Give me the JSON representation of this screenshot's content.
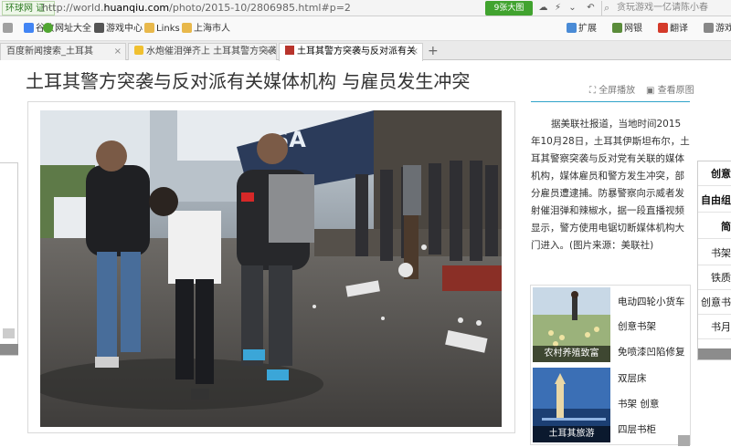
{
  "browser": {
    "site_badge": "环球网 证 ·",
    "url_prefix": "http://world.",
    "url_host": "huanqiu.com",
    "url_path": "/photo/2015-10/2806985.html#p=2",
    "translate_label": "9张大图",
    "search_placeholder": "贪玩游戏一亿请陈小春"
  },
  "bookmarks": [
    {
      "label": "谷歌",
      "color": "#4285f4"
    },
    {
      "label": "网址大全",
      "color": "#51a632"
    },
    {
      "label": "游戏中心",
      "color": "#555555"
    },
    {
      "label": "Links",
      "color": "#e8b84b"
    },
    {
      "label": "上海市人",
      "color": "#e8b84b"
    }
  ],
  "toolbar_right": [
    {
      "label": "扩展",
      "color": "#4a8bd6"
    },
    {
      "label": "网银",
      "color": "#5a8c3a"
    },
    {
      "label": "翻译",
      "color": "#d43a2a"
    },
    {
      "label": "游戏",
      "color": "#888888"
    }
  ],
  "tabs": [
    {
      "label": "百度新闻搜索_土耳其",
      "active": false
    },
    {
      "label": "水炮催泪弹齐上 土耳其警方突袭",
      "active": false
    },
    {
      "label": "土耳其警方突袭与反对派有关",
      "active": true
    }
  ],
  "page": {
    "headline": "土耳其警方突袭与反对派有关媒体机构 与雇员发生冲突",
    "fullscreen_label": "全屏播放",
    "view_original_label": "查看原图",
    "article_text": "据美联社报道，当地时间2015年10月28日，土耳其伊斯坦布尔，土耳其警察突袭与反对党有关联的媒体机构，媒体雇员和警方发生冲突，部分雇员遭逮捕。防暴警察向示威者发射催泪弹和辣椒水，据一段直播视频显示，警方使用电锯切断媒体机构大门进入。(图片来源：美联社)",
    "photo_alt": "Police officers in vests escort a detained man across a littered street"
  },
  "recommend": [
    {
      "caption": "农村养殖致富",
      "links": [
        "电动四轮小货车",
        "创意书架",
        "免喷漆凹陷修复"
      ]
    },
    {
      "caption": "土耳其旅游",
      "links": [
        "双层床",
        "书架 创意",
        "四层书柜"
      ]
    }
  ],
  "right_sidebar": [
    {
      "label": "创意",
      "bold": true
    },
    {
      "label": "自由组",
      "bold": true
    },
    {
      "label": "简",
      "bold": true
    },
    {
      "label": "书架",
      "bold": false
    },
    {
      "label": "铁质",
      "bold": false
    },
    {
      "label": "创意书",
      "bold": false
    },
    {
      "label": "书月",
      "bold": false
    }
  ]
}
